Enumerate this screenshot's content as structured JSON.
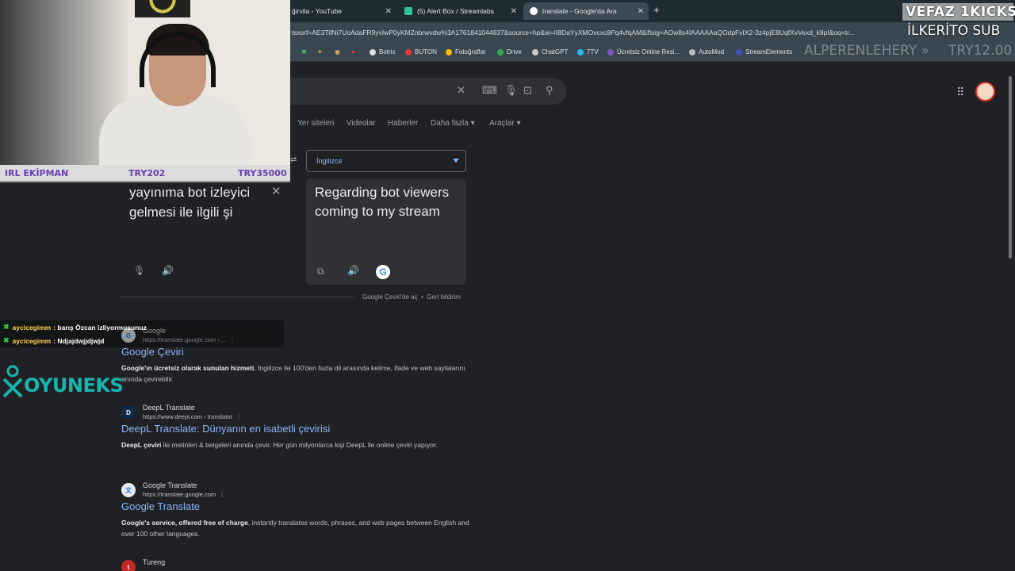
{
  "browser": {
    "tabs": [
      {
        "label": "ğirvila - YouTube"
      },
      {
        "label": "(5) Alert Box / Streamlabs"
      },
      {
        "label": "translate - Google'da Ara"
      }
    ],
    "url": "tsxsrf=AE3TifNi7UoAdaFR9yvIwP0yKMZnbrwvdw%3A1761841044837&source=hp&ei=II8DaYyXMOvcxc8Pq4vfqAM&iflsig=AOw8s4IAAAAAaQOdpFvIX2-3z4pjE8UqfXvVexd_k8pI&oq=tr...",
    "bookmarks": [
      "Botrix",
      "BUTON",
      "Fotoğraflar",
      "Drive",
      "ChatGPT",
      "7TV",
      "Ücretsiz Online Resi...",
      "AutoMod",
      "StreamElements"
    ]
  },
  "google": {
    "nav_tabs": [
      "Yer siteleri",
      "Videolar",
      "Haberler",
      "Daha fazla",
      "Araçlar"
    ],
    "translate": {
      "target_lang": "İngilizce",
      "source_text": "yayınıma bot izleyici gelmesi ile ilgili şi",
      "target_text": "Regarding bot viewers coming to my stream",
      "open_label": "Google Çeviri'de aç",
      "feedback_label": "Geri bildirim"
    },
    "results": [
      {
        "site": "Google",
        "url": "https://translate.google.com › ...",
        "title": "Google Çeviri",
        "desc_bold": "Google'ın ücretsiz olarak sunulan hizmeti",
        "desc": ", İngilizce ile 100'den fazla dil arasında kelime, ifade ve web sayfalarını anında çevirebilir."
      },
      {
        "site": "DeepL Translate",
        "url": "https://www.deepl.com › translator",
        "title": "DeepL Translate: Dünyanın en isabetli çevirisi",
        "desc_bold": "DeepL çeviri",
        "desc": " ile metinleri & belgeleri anında çevir. Her gün milyonlarca kişi DeepL ile online çeviri yapıyor."
      },
      {
        "site": "Google Translate",
        "url": "https://translate.google.com",
        "title": "Google Translate",
        "desc_bold": "Google's service, offered free of charge",
        "desc": ", instantly translates words, phrases, and web pages between English and over 100 other languages."
      },
      {
        "site": "Tureng",
        "url": "",
        "title": "",
        "desc_bold": "",
        "desc": ""
      }
    ]
  },
  "overlay": {
    "stats": {
      "label": "IRL EKİPMAN",
      "current": "TRY202",
      "goal": "TRY35000"
    },
    "chat": [
      {
        "user": "aycicegimm",
        "message": ": barış Özcan izliyormusunuz"
      },
      {
        "user": "aycicegimm",
        "message": ": Ndjajdwjjdjwjd"
      }
    ],
    "sponsor": "OYUNEKS",
    "top_goal": "VEFAZ 1KICKS",
    "sub_text": "İLKERİTO SUB",
    "ghost_left": "ALPERENLEHERY »",
    "ghost_right": "TRY12.00"
  },
  "colors": {
    "accent_link": "#8ab4f8",
    "overlay_purple": "#6a3fb5",
    "sponsor": "#17b5b0"
  }
}
